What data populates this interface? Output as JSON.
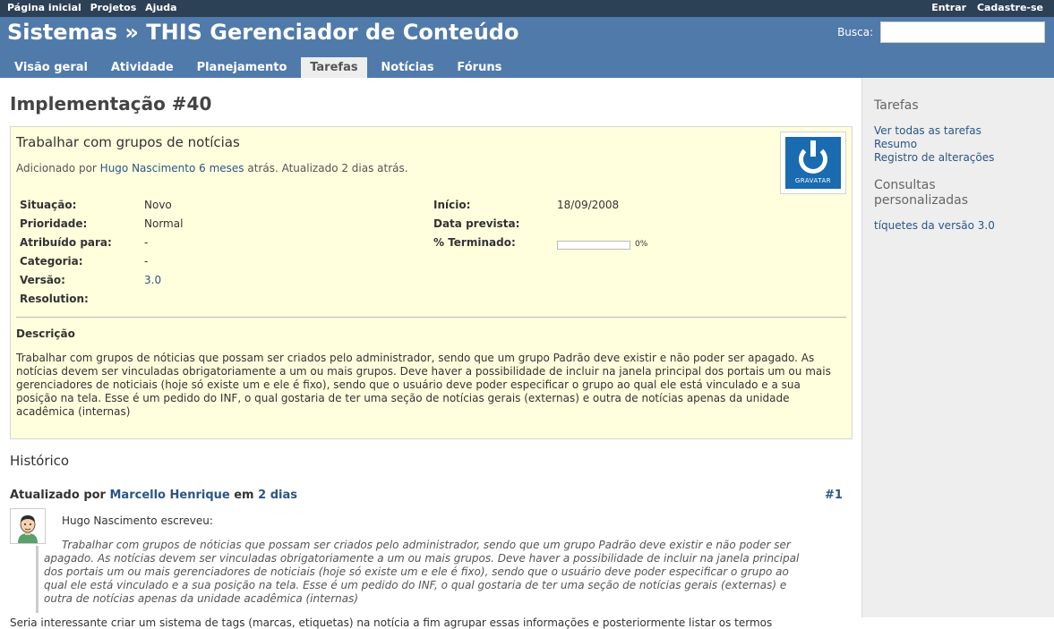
{
  "top_menu": {
    "home": "Página inicial",
    "projects": "Projetos",
    "help": "Ajuda",
    "login": "Entrar",
    "register": "Cadastre-se"
  },
  "header": {
    "title": "Sistemas » THIS Gerenciador de Conteúdo",
    "search_label": "Busca:",
    "search_value": ""
  },
  "main_menu": {
    "tabs": [
      "Visão geral",
      "Atividade",
      "Planejamento",
      "Tarefas",
      "Notícias",
      "Fóruns"
    ],
    "selected": "Tarefas"
  },
  "issue": {
    "heading": "Implementação #40",
    "subject": "Trabalhar com grupos de notícias",
    "added_by_prefix": "Adicionado por ",
    "author": "Hugo Nascimento",
    "added_ago": "6 meses",
    "updated_suffix": " atrás. Atualizado 2 dias atrás.",
    "gravatar_text": "GRAVATAR",
    "attributes": {
      "status_label": "Situação:",
      "status": "Novo",
      "priority_label": "Prioridade:",
      "priority": "Normal",
      "assigned_label": "Atribuído para:",
      "assigned": "-",
      "category_label": "Categoria:",
      "category": "-",
      "version_label": "Versão:",
      "version": "3.0",
      "resolution_label": "Resolution:",
      "resolution": "",
      "start_label": "Início:",
      "start": "18/09/2008",
      "due_label": "Data prevista:",
      "due": "",
      "done_label": "% Terminado:",
      "done": "0%",
      "done_ratio": 0
    },
    "description_label": "Descrição",
    "description": "Trabalhar com grupos de nóticias que possam ser criados pelo administrador, sendo que um grupo Padrão deve existir e não poder ser apagado. As notícias devem ser vinculadas obrigatoriamente a um ou mais grupos. Deve haver a possibilidade de incluir na janela principal dos portais um ou mais gerenciadores de noticiais (hoje só existe um e ele é fixo), sendo que o usuário deve poder especificar o grupo ao qual ele está vinculado e a sua posição na tela. Esse é um pedido do INF, o qual gostaria de ter uma seção de notícias gerais (externas) e outra de notícias apenas da unidade acadêmica (internas)"
  },
  "history": {
    "title": "Histórico",
    "journal": {
      "updated_by": "Atualizado por ",
      "user": "Marcello Henrique",
      "in": " em ",
      "when": "2 dias",
      "number": "#1",
      "wrote": "Hugo Nascimento escreveu:",
      "quote": "Trabalhar com grupos de nóticias que possam ser criados pelo administrador, sendo que um grupo Padrão deve existir e não poder ser apagado. As notícias devem ser vinculadas obrigatoriamente a um ou mais grupos. Deve haver a possibilidade de incluir na janela principal dos portais um ou mais gerenciadores de noticiais (hoje só existe um e ele é fixo), sendo que o usuário deve poder especificar o grupo ao qual ele está vinculado e a sua posição na tela. Esse é um pedido do INF, o qual gostaria de ter uma seção de notícias gerais (externas) e outra de notícias apenas da unidade acadêmica (internas)",
      "reply": "Seria interessante criar um sistema de tags (marcas, etiquetas) na notícia a fim agrupar essas informações e posteriormente listar os termos"
    }
  },
  "sidebar": {
    "tasks_title": "Tarefas",
    "links": [
      "Ver todas as tarefas",
      "Resumo",
      "Registro de alterações"
    ],
    "queries_title_line1": "Consultas",
    "queries_title_line2": "personalizadas",
    "queries": [
      "tíquetes da versão 3.0"
    ]
  }
}
